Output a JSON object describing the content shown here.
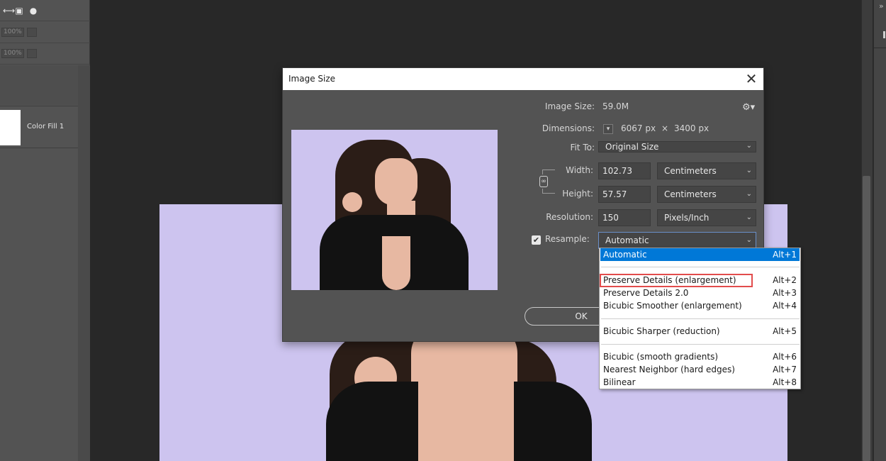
{
  "left_panel": {
    "opacity_1": "100%",
    "opacity_2": "100%",
    "layer_name": "Color Fill 1",
    "tool_icons": [
      "move-icon",
      "lock-icon",
      "pin-icon"
    ]
  },
  "dialog": {
    "title": "Image Size",
    "close_glyph": "✕",
    "image_size_label": "Image Size:",
    "image_size_value": "59.0M",
    "dimensions_label": "Dimensions:",
    "dimensions_width": "6067 px",
    "dimensions_times": "×",
    "dimensions_height": "3400 px",
    "fit_to_label": "Fit To:",
    "fit_to_value": "Original Size",
    "width_label": "Width:",
    "width_value": "102.73",
    "width_unit": "Centimeters",
    "height_label": "Height:",
    "height_value": "57.57",
    "height_unit": "Centimeters",
    "resolution_label": "Resolution:",
    "resolution_value": "150",
    "resolution_unit": "Pixels/Inch",
    "resample_label": "Resample:",
    "resample_checked": true,
    "resample_value": "Automatic",
    "ok_label": "OK"
  },
  "resample_dropdown": {
    "items": [
      {
        "label": "Automatic",
        "shortcut": "Alt+1",
        "selected": true
      },
      {
        "label": "Preserve Details (enlargement)",
        "shortcut": "Alt+2",
        "highlighted": true
      },
      {
        "label": "Preserve Details 2.0",
        "shortcut": "Alt+3"
      },
      {
        "label": "Bicubic Smoother (enlargement)",
        "shortcut": "Alt+4"
      },
      {
        "label": "Bicubic Sharper (reduction)",
        "shortcut": "Alt+5"
      },
      {
        "label": "Bicubic (smooth gradients)",
        "shortcut": "Alt+6"
      },
      {
        "label": "Nearest Neighbor (hard edges)",
        "shortcut": "Alt+7"
      },
      {
        "label": "Bilinear",
        "shortcut": "Alt+8"
      }
    ]
  },
  "colors": {
    "canvas_background": "#cdc4ef",
    "selection": "#0078d7",
    "highlight_outline": "#e24c4c"
  }
}
